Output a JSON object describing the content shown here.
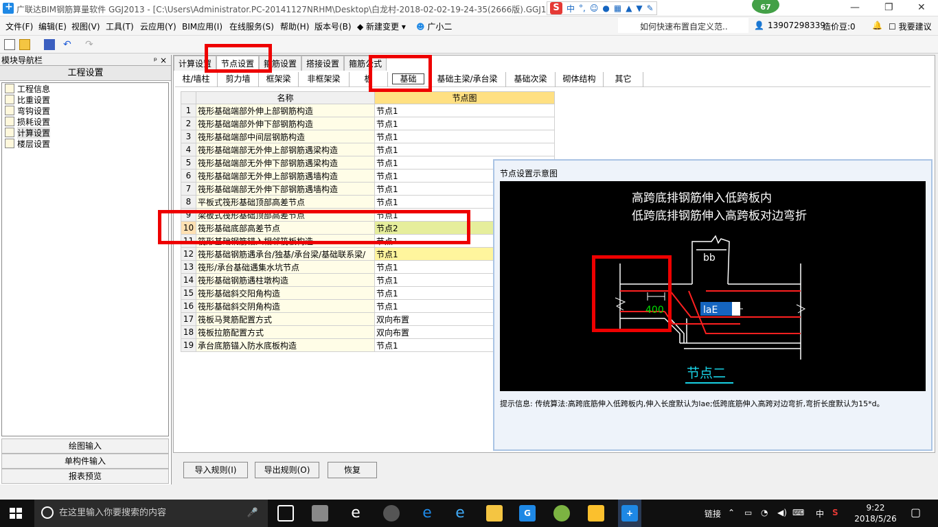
{
  "titlebar": {
    "title": "广联达BIM钢筋算量软件 GGJ2013 - [C:\\Users\\Administrator.PC-20141127NRHM\\Desktop\\白龙村-2018-02-02-19-24-35(2666版).GGJ12]",
    "ime_mode": "中",
    "badge": "67"
  },
  "menubar": {
    "items": [
      "文件(F)",
      "编辑(E)",
      "视图(V)",
      "工具(T)",
      "云应用(Y)",
      "BIM应用(I)",
      "在线服务(S)",
      "帮助(H)",
      "版本号(B)",
      "新建变更",
      "广小二"
    ],
    "help_text": "如何快速布置自定义范..",
    "phone": "13907298339",
    "price_bean": "造价豆:0",
    "suggest": "我要建议"
  },
  "leftnav": {
    "title": "模块导航栏",
    "pin": "ᵖ",
    "close": "×",
    "section": "工程设置",
    "items": [
      "工程信息",
      "比重设置",
      "弯钩设置",
      "损耗设置",
      "计算设置",
      "楼层设置"
    ],
    "bottom": [
      "绘图输入",
      "单构件输入",
      "报表预览"
    ]
  },
  "main": {
    "top_tabs": [
      "计算设置",
      "节点设置",
      "箍筋设置",
      "搭接设置",
      "箍筋公式"
    ],
    "sub_tabs": [
      "柱/墙柱",
      "剪力墙",
      "框架梁",
      "非框架梁",
      "板",
      "基础",
      "基础主梁/承台梁",
      "基础次梁",
      "砌体结构",
      "其它"
    ],
    "grid": {
      "col_name": "名称",
      "col_node": "节点图",
      "rows": [
        {
          "n": "1",
          "name": "筏形基础端部外伸上部钢筋构造",
          "val": "节点1"
        },
        {
          "n": "2",
          "name": "筏形基础端部外伸下部钢筋构造",
          "val": "节点1"
        },
        {
          "n": "3",
          "name": "筏形基础端部中间层钢筋构造",
          "val": "节点1"
        },
        {
          "n": "4",
          "name": "筏形基础端部无外伸上部钢筋遇梁构造",
          "val": "节点1"
        },
        {
          "n": "5",
          "name": "筏形基础端部无外伸下部钢筋遇梁构造",
          "val": "节点1"
        },
        {
          "n": "6",
          "name": "筏形基础端部无外伸上部钢筋遇墙构造",
          "val": "节点1"
        },
        {
          "n": "7",
          "name": "筏形基础端部无外伸下部钢筋遇墙构造",
          "val": "节点1"
        },
        {
          "n": "8",
          "name": "平板式筏形基础顶部高差节点",
          "val": "节点1"
        },
        {
          "n": "9",
          "name": "梁板式筏形基础顶部高差节点",
          "val": "节点1"
        },
        {
          "n": "10",
          "name": "筏形基础底部高差节点",
          "val": "节点2"
        },
        {
          "n": "11",
          "name": "筏形基础钢筋锚入相邻筏板构造",
          "val": "节点1"
        },
        {
          "n": "12",
          "name": "筏形基础钢筋遇承台/独基/承台梁/基础联系梁/",
          "val": "节点1"
        },
        {
          "n": "13",
          "name": "筏形/承台基础遇集水坑节点",
          "val": "节点1"
        },
        {
          "n": "14",
          "name": "筏形基础钢筋遇柱墩构造",
          "val": "节点1"
        },
        {
          "n": "15",
          "name": "筏形基础斜交阳角构造",
          "val": "节点1"
        },
        {
          "n": "16",
          "name": "筏形基础斜交阴角构造",
          "val": "节点1"
        },
        {
          "n": "17",
          "name": "筏板马凳筋配置方式",
          "val": "双向布置"
        },
        {
          "n": "18",
          "name": "筏板拉筋配置方式",
          "val": "双向布置"
        },
        {
          "n": "19",
          "name": "承台底筋锚入防水底板构造",
          "val": "节点1"
        }
      ]
    },
    "buttons": [
      "导入规则(I)",
      "导出规则(O)",
      "恢复"
    ]
  },
  "diagram": {
    "title": "节点设置示意图",
    "line1": "高跨底排钢筋伸入低跨板内",
    "line2": "低跨底排钢筋伸入高跨板对边弯折",
    "dim_bb": "bb",
    "dim_400": "400",
    "dim_lab": "laE",
    "caption": "节点二",
    "hint": "提示信息:  传统算法:高跨底筋伸入低跨板内,伸入长度默认为lae;低跨底筋伸入高跨对边弯折,弯折长度默认为15*d。",
    "colors": {
      "rebar": "#ff2020",
      "dim": "#00e000",
      "caption": "#19d3e6",
      "select": "#1565c0"
    }
  },
  "taskbar": {
    "search_placeholder": "在这里输入你要搜索的内容",
    "tray_link": "链接",
    "ime": "中",
    "time": "9:22",
    "date": "2018/5/26"
  }
}
